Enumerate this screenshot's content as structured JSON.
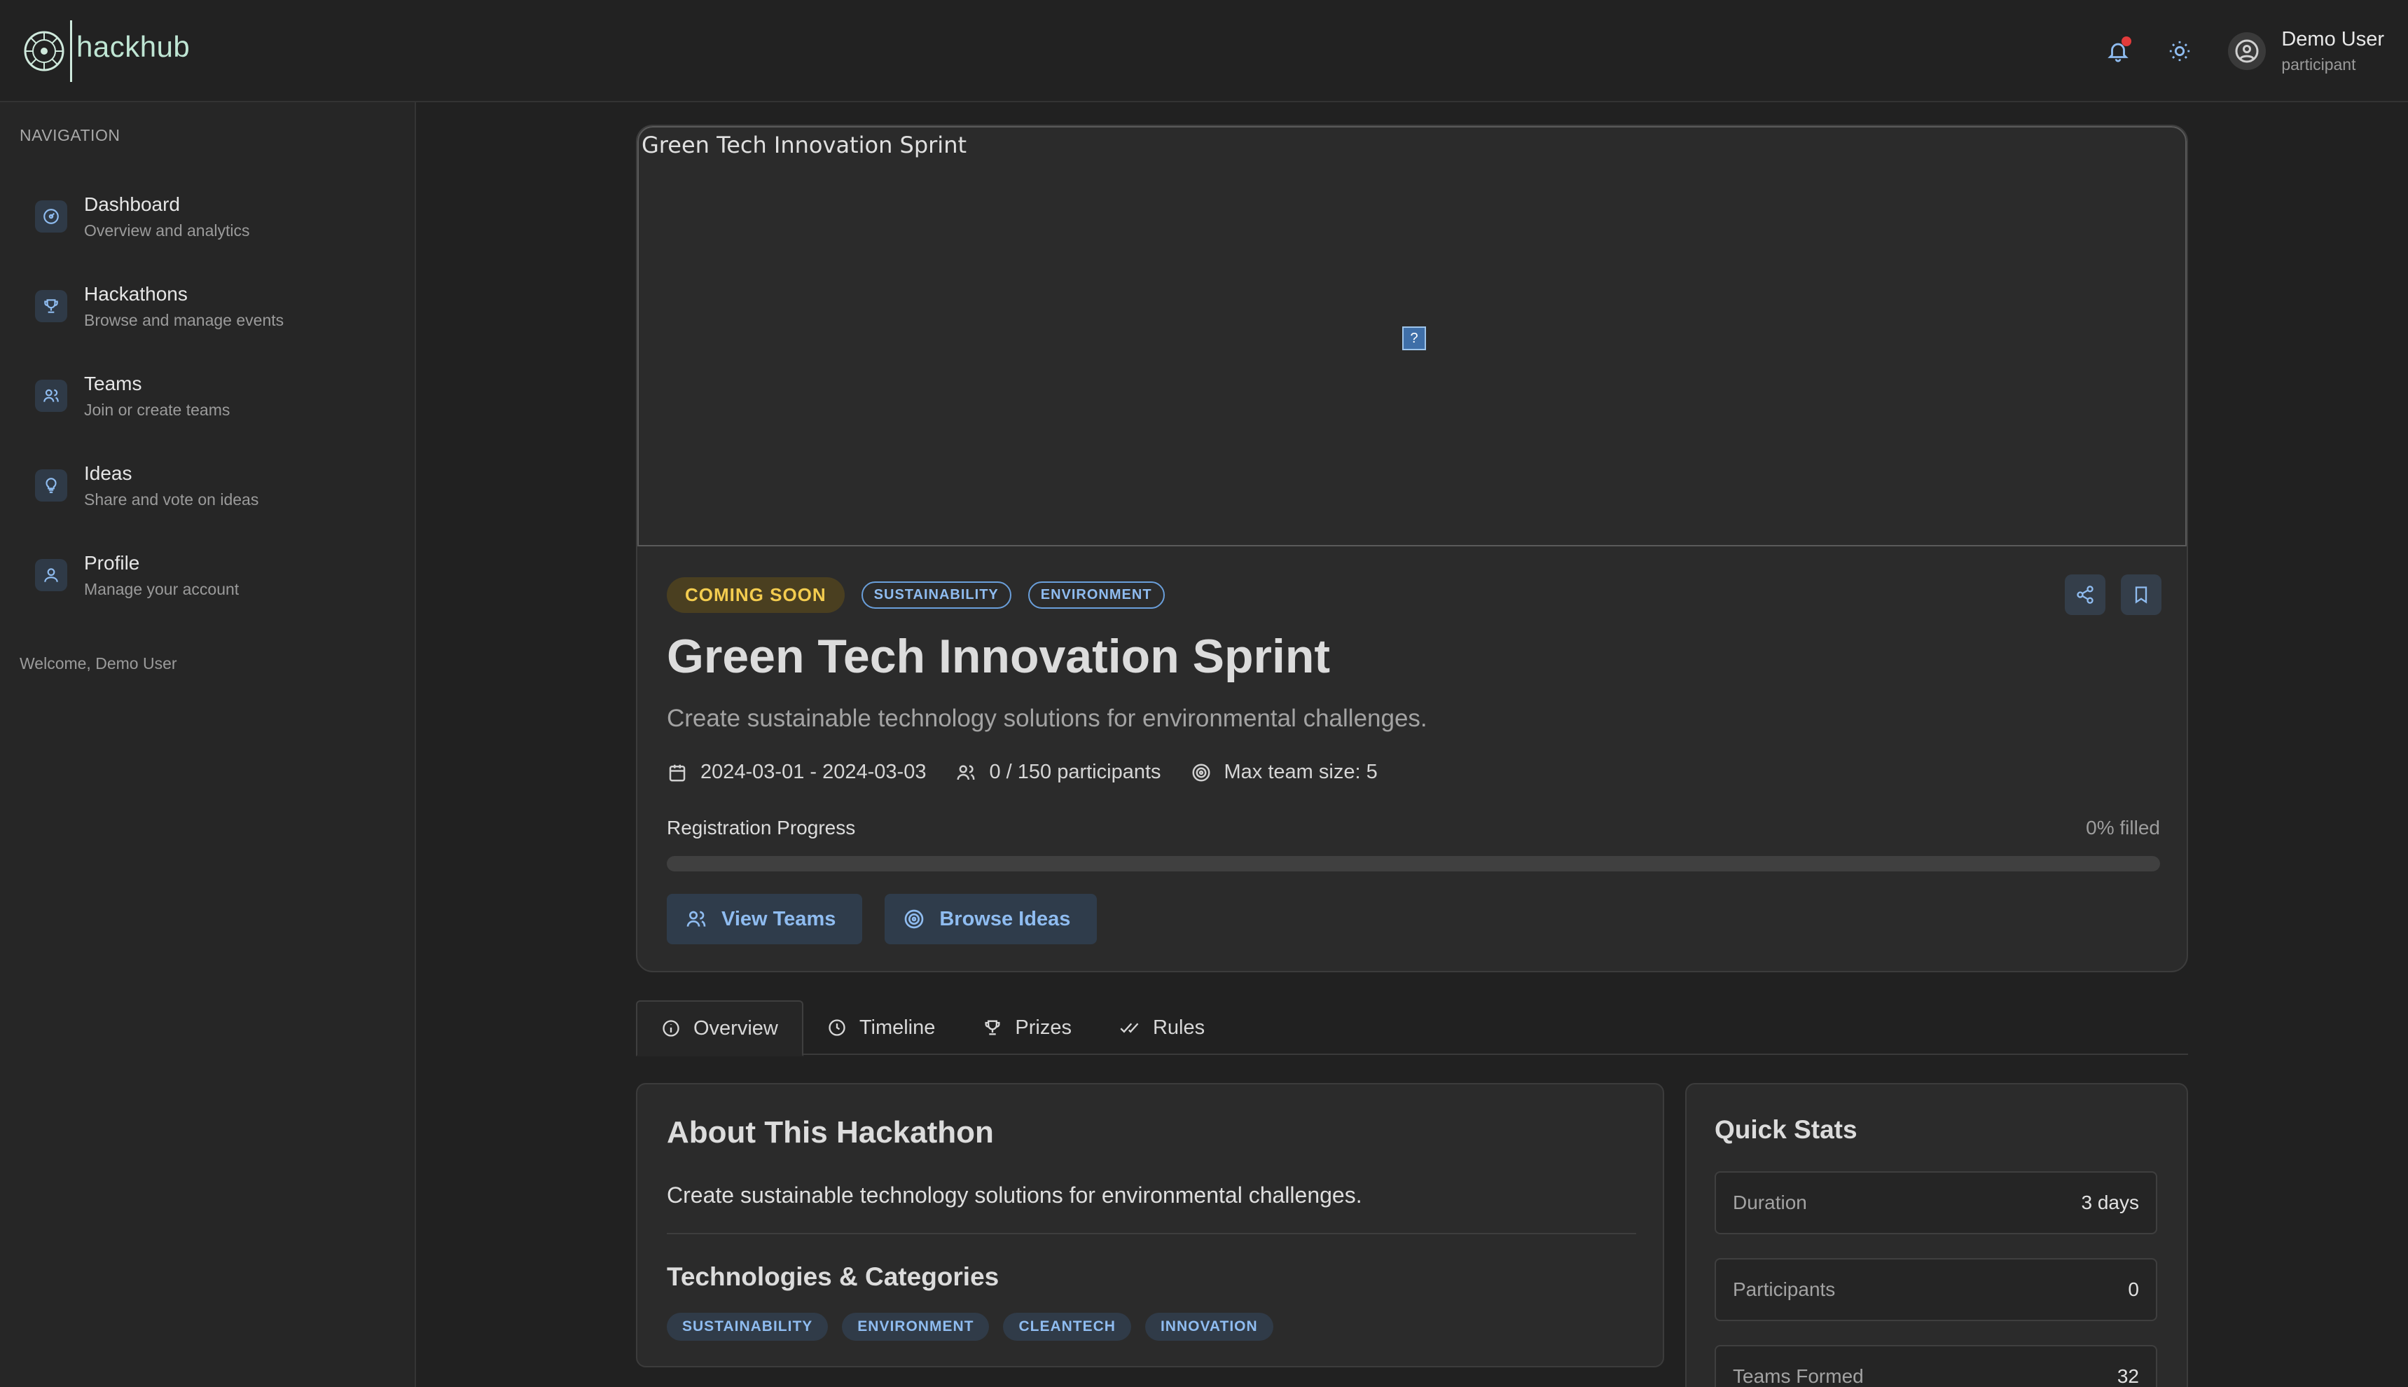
{
  "brand": {
    "name": "hackhub"
  },
  "header": {
    "user_name": "Demo User",
    "user_role": "participant"
  },
  "sidebar": {
    "heading": "NAVIGATION",
    "items": [
      {
        "label": "Dashboard",
        "sub": "Overview and analytics",
        "icon": "dashboard-icon"
      },
      {
        "label": "Hackathons",
        "sub": "Browse and manage events",
        "icon": "trophy-icon"
      },
      {
        "label": "Teams",
        "sub": "Join or create teams",
        "icon": "users-icon"
      },
      {
        "label": "Ideas",
        "sub": "Share and vote on ideas",
        "icon": "lightbulb-icon"
      },
      {
        "label": "Profile",
        "sub": "Manage your account",
        "icon": "user-icon"
      }
    ],
    "welcome": "Welcome, Demo User"
  },
  "event": {
    "image_alt": "Green Tech Innovation Sprint",
    "status": "COMING SOON",
    "tags": [
      "SUSTAINABILITY",
      "ENVIRONMENT"
    ],
    "title": "Green Tech Innovation Sprint",
    "description": "Create sustainable technology solutions for environmental challenges.",
    "dates": "2024-03-01 - 2024-03-03",
    "participants": "0 / 150 participants",
    "team_size": "Max team size: 5",
    "registration_label": "Registration Progress",
    "registration_pct_text": "0% filled",
    "registration_fraction": 0,
    "buttons": {
      "view_teams": "View Teams",
      "browse_ideas": "Browse Ideas"
    }
  },
  "tabs": [
    {
      "label": "Overview",
      "icon": "info-icon",
      "active": true
    },
    {
      "label": "Timeline",
      "icon": "clock-icon",
      "active": false
    },
    {
      "label": "Prizes",
      "icon": "trophy-icon",
      "active": false
    },
    {
      "label": "Rules",
      "icon": "check-icon",
      "active": false
    }
  ],
  "about": {
    "title": "About This Hackathon",
    "text": "Create sustainable technology solutions for environmental challenges.",
    "tech_title": "Technologies & Categories",
    "tech_tags": [
      "SUSTAINABILITY",
      "ENVIRONMENT",
      "CLEANTECH",
      "INNOVATION"
    ]
  },
  "stats": {
    "title": "Quick Stats",
    "rows": [
      {
        "label": "Duration",
        "value": "3 days"
      },
      {
        "label": "Participants",
        "value": "0"
      },
      {
        "label": "Teams Formed",
        "value": "32"
      }
    ]
  },
  "colors": {
    "accent": "#8fbcf0",
    "status_soon": "#f3cc4f",
    "notification": "#e23b3b",
    "brand": "#bfe6d4"
  }
}
